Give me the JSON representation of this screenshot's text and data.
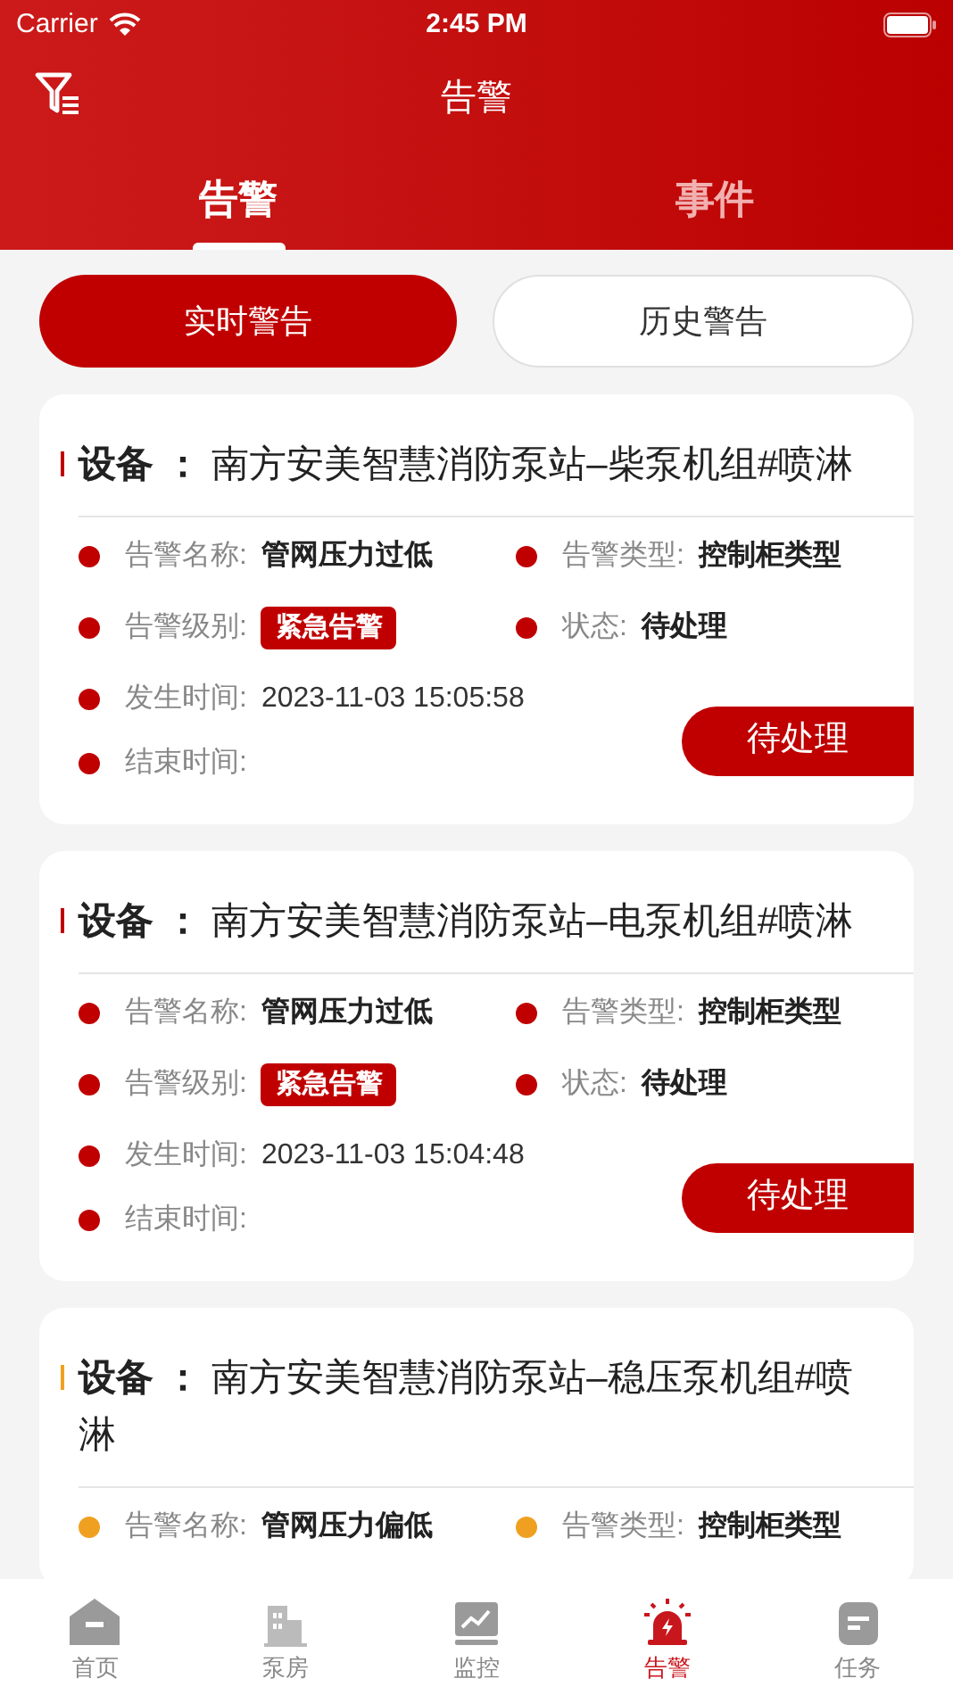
{
  "status_bar": {
    "carrier": "Carrier",
    "time": "2:45 PM"
  },
  "nav": {
    "title": "告警"
  },
  "tabs": [
    {
      "label": "告警",
      "selected": true
    },
    {
      "label": "事件",
      "selected": false
    }
  ],
  "segments": [
    {
      "label": "实时警告",
      "selected": true
    },
    {
      "label": "历史警告",
      "selected": false
    }
  ],
  "alarms": [
    {
      "color": "#c00000",
      "title": "**设备 ：** 南方安美智慧消防泵站–柴泵机组#喷淋",
      "rows": [
        [
          {
            "label": "告警名称:",
            "value": "管网压力过低",
            "kind": "text"
          },
          {
            "label": "告警类型:",
            "value": "控制柜类型",
            "kind": "text"
          }
        ],
        [
          {
            "label": "告警级别:",
            "value": "紧急告警",
            "kind": "badge"
          },
          {
            "label": "状态:",
            "value": "待处理",
            "kind": "text"
          }
        ],
        [
          {
            "label": "发生时间:",
            "value": "2023-11-03 15:05:58",
            "kind": "plain"
          }
        ],
        [
          {
            "label": "结束时间:",
            "kind": "plain"
          }
        ]
      ],
      "action": "待处理"
    },
    {
      "color": "#c00000",
      "title": "**设备 ：** 南方安美智慧消防泵站–电泵机组#喷淋",
      "rows": [
        [
          {
            "label": "告警名称:",
            "value": "管网压力过低",
            "kind": "text"
          },
          {
            "label": "告警类型:",
            "value": "控制柜类型",
            "kind": "text"
          }
        ],
        [
          {
            "label": "告警级别:",
            "value": "紧急告警",
            "kind": "badge"
          },
          {
            "label": "状态:",
            "value": "待处理",
            "kind": "text"
          }
        ],
        [
          {
            "label": "发生时间:",
            "value": "2023-11-03 15:04:48",
            "kind": "plain"
          }
        ],
        [
          {
            "label": "结束时间:",
            "kind": "plain"
          }
        ]
      ],
      "action": "待处理"
    },
    {
      "color": "#f0a020",
      "title": "**设备 ：** 南方安美智慧消防泵站–稳压泵机组#喷淋",
      "rows": [
        [
          {
            "label": "告警名称:",
            "value": "管网压力偏低",
            "kind": "text"
          },
          {
            "label": "告警类型:",
            "value": "控制柜类型",
            "kind": "text"
          }
        ]
      ]
    }
  ],
  "bottom_tabs": [
    {
      "label": "首页",
      "selected": false
    },
    {
      "label": "泵房",
      "selected": false
    },
    {
      "label": "监控",
      "selected": false
    },
    {
      "label": "告警",
      "selected": true
    },
    {
      "label": "任务",
      "selected": false
    }
  ]
}
